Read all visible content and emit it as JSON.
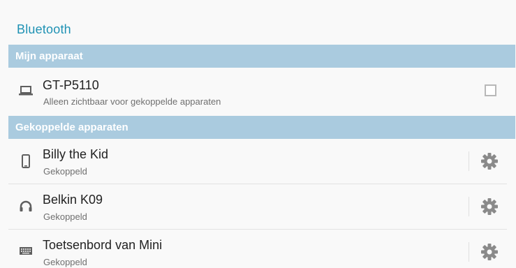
{
  "page": {
    "title": "Bluetooth"
  },
  "sections": {
    "my_device": {
      "header": "Mijn apparaat",
      "device": {
        "name": "GT-P5110",
        "subtitle": "Alleen zichtbaar voor gekoppelde apparaten",
        "icon": "laptop-icon",
        "visible_checked": false
      }
    },
    "paired": {
      "header": "Gekoppelde apparaten",
      "devices": [
        {
          "name": "Billy the Kid",
          "status": "Gekoppeld",
          "icon": "phone-icon"
        },
        {
          "name": "Belkin K09",
          "status": "Gekoppeld",
          "icon": "headphones-icon"
        },
        {
          "name": "Toetsenbord van Mini",
          "status": "Gekoppeld",
          "icon": "keyboard-icon"
        }
      ]
    }
  },
  "colors": {
    "accent": "#1f92b4",
    "section_header_bg": "#aacbdf",
    "icon_gray": "#5f5f5f",
    "gear_gray": "#8a8a8a"
  }
}
